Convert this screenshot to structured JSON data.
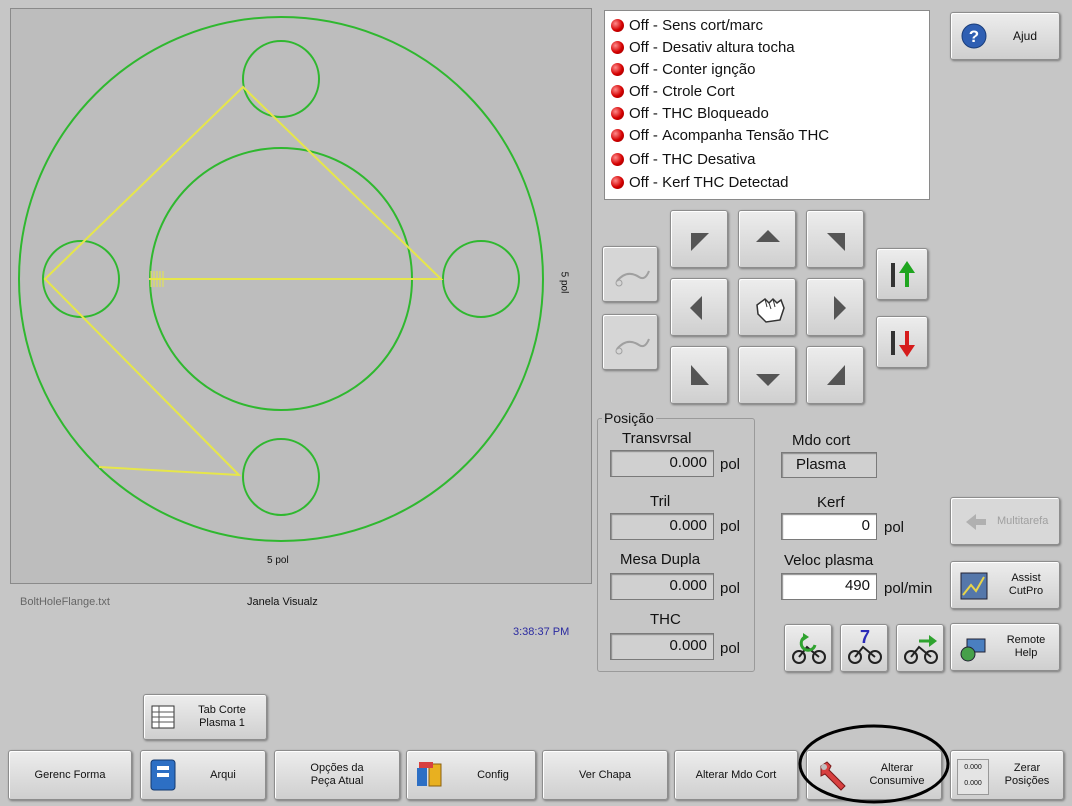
{
  "viewer": {
    "file_name": "BoltHoleFlange.txt",
    "title": "Janela Visualz",
    "dim_width": "5 pol",
    "dim_height": "5 pol",
    "clock": "3:38:37 PM"
  },
  "status_list": [
    {
      "state": "Off -",
      "label": "Sens cort/marc"
    },
    {
      "state": "Off -",
      "label": "Desativ altura tocha"
    },
    {
      "state": "Off -",
      "label": "Conter ignção"
    },
    {
      "state": "Off -",
      "label": "Ctrole Cort"
    },
    {
      "state": "Off -",
      "label": "THC Bloqueado"
    },
    {
      "state": "Off -",
      "label": "Acompanha Tensão THC"
    },
    {
      "state": "Off -",
      "label": "THC Desativa"
    },
    {
      "state": "Off -",
      "label": "Kerf THC Detectad"
    }
  ],
  "help_button": {
    "label": "Ajud"
  },
  "position": {
    "group_label": "Posição",
    "transversal": {
      "label": "Transvrsal",
      "value": "0.000",
      "unit": "pol"
    },
    "tril": {
      "label": "Tril",
      "value": "0.000",
      "unit": "pol"
    },
    "mesa_dupla": {
      "label": "Mesa Dupla",
      "value": "0.000",
      "unit": "pol"
    },
    "thc": {
      "label": "THC",
      "value": "0.000",
      "unit": "pol"
    }
  },
  "cut": {
    "mode_label": "Mdo cort",
    "mode_value": "Plasma",
    "kerf_label": "Kerf",
    "kerf_value": "0",
    "kerf_unit": "pol",
    "speed_label": "Veloc plasma",
    "speed_value": "490",
    "speed_unit": "pol/min"
  },
  "right_buttons": {
    "multitarefa": "Multitarefa",
    "assist_line1": "Assist",
    "assist_line2": "CutPro",
    "remote_line1": "Remote",
    "remote_line2": "Help",
    "counter_label": "7"
  },
  "tab_corte": {
    "line1": "Tab Corte",
    "line2": "Plasma 1"
  },
  "bottom_bar": {
    "gerenc_forma": "Gerenc Forma",
    "arqui": "Arqui",
    "opcoes_line1": "Opções da",
    "opcoes_line2": "Peça Atual",
    "config": "Config",
    "ver_chapa": "Ver Chapa",
    "alterar_mdo": "Alterar Mdo Cort",
    "alterar_cons_line1": "Alterar",
    "alterar_cons_line2": "Consumive",
    "zerar_line1": "Zerar",
    "zerar_line2": "Posições",
    "zerar_mini1": "0.000",
    "zerar_mini2": "0.000"
  },
  "colors": {
    "part_outline": "#2fb82f",
    "cut_path": "#e6e64a",
    "status_led": "#d40000",
    "clock_text": "#2a2aa0",
    "highlight_circle": "#000000"
  }
}
